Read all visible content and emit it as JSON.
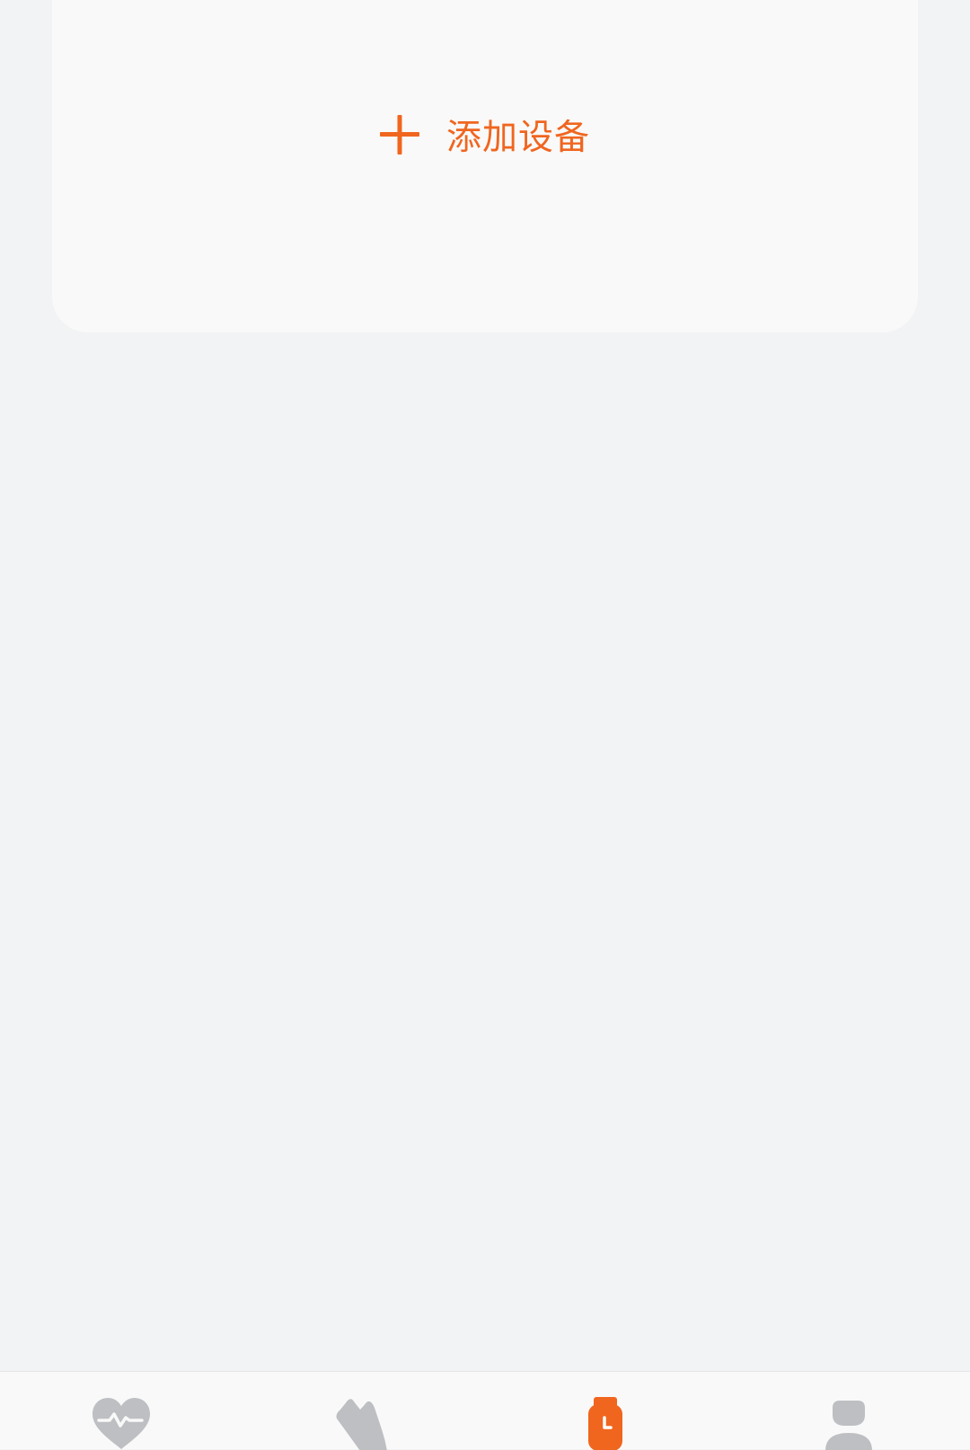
{
  "add_device": {
    "label": "添加设备",
    "plus_icon": "plus-icon"
  },
  "tabbar": {
    "items": [
      {
        "id": "health",
        "icon": "heart-pulse-icon",
        "active": false
      },
      {
        "id": "sport",
        "icon": "shoe-icon",
        "active": false
      },
      {
        "id": "device",
        "icon": "watch-icon",
        "active": true
      },
      {
        "id": "profile",
        "icon": "person-icon",
        "active": false
      }
    ]
  },
  "colors": {
    "accent": "#f0661f",
    "inactive_icon": "#bdbfc2",
    "page_background": "#f2f3f5",
    "card_background": "#f9f9f9"
  }
}
